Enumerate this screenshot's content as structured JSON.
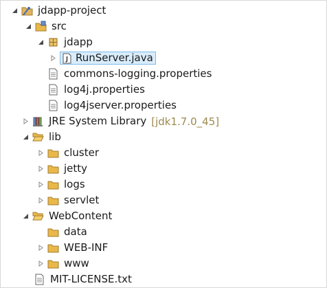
{
  "tree": {
    "project": {
      "label": "jdapp-project"
    },
    "src": {
      "label": "src"
    },
    "package_jdapp": {
      "label": "jdapp"
    },
    "runserver": {
      "label": "RunServer.java"
    },
    "commons_logging": {
      "label": "commons-logging.properties"
    },
    "log4j": {
      "label": "log4j.properties"
    },
    "log4jserver": {
      "label": "log4jserver.properties"
    },
    "jre": {
      "label": "JRE System Library",
      "decoration": "[jdk1.7.0_45]"
    },
    "lib": {
      "label": "lib"
    },
    "cluster": {
      "label": "cluster"
    },
    "jetty": {
      "label": "jetty"
    },
    "logs": {
      "label": "logs"
    },
    "servlet": {
      "label": "servlet"
    },
    "webcontent": {
      "label": "WebContent"
    },
    "data": {
      "label": "data"
    },
    "webinf": {
      "label": "WEB-INF"
    },
    "www": {
      "label": "www"
    },
    "license": {
      "label": "MIT-LICENSE.txt"
    }
  },
  "colors": {
    "folder": "#e8b84a",
    "selection_bg": "#d9ecfb",
    "selection_border": "#7db9e8",
    "decoration_text": "#9c8a4e"
  },
  "icons": {
    "expanded": "triangle-down-icon",
    "collapsed": "triangle-right-icon",
    "project": "java-project-icon",
    "source_folder": "source-folder-icon",
    "package": "package-icon",
    "java_file": "java-file-icon",
    "text_file": "text-file-icon",
    "library": "library-icon",
    "folder": "folder-icon"
  }
}
